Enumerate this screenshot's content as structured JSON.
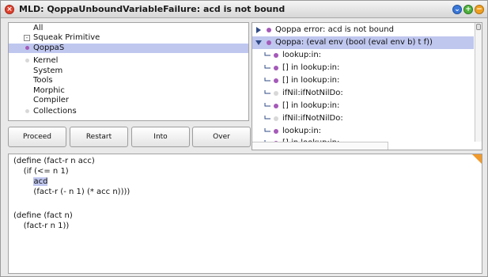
{
  "window": {
    "title": "MLD: QoppaUnboundVariableFailure: acd is not bound",
    "close_glyph": "×",
    "menu_glyph": "⌄",
    "expand_glyph": "+",
    "collapse_glyph": "−"
  },
  "class_list": {
    "items": [
      {
        "label": "All",
        "marker": "none",
        "selected": false
      },
      {
        "label": "Squeak Primitive",
        "marker": "box",
        "selected": false
      },
      {
        "label": "QoppaS",
        "marker": "purple",
        "selected": true
      },
      {
        "label": "Kernel",
        "marker": "grey",
        "selected": false
      },
      {
        "label": "System",
        "marker": "none",
        "selected": false
      },
      {
        "label": "Tools",
        "marker": "none",
        "selected": false
      },
      {
        "label": "Morphic",
        "marker": "none",
        "selected": false
      },
      {
        "label": "Compiler",
        "marker": "none",
        "selected": false
      },
      {
        "label": "Collections",
        "marker": "grey",
        "selected": false
      }
    ]
  },
  "buttons": {
    "proceed": "Proceed",
    "restart": "Restart",
    "into": "Into",
    "over": "Over"
  },
  "stack": {
    "frames": [
      {
        "label": "Qoppa error: acd is not bound",
        "kind": "collapsed",
        "marker": "purple",
        "selected": false
      },
      {
        "label": "Qoppa: (eval env (bool (eval env b) t f))",
        "kind": "expanded",
        "marker": "purple",
        "selected": true
      },
      {
        "label": "lookup:in:",
        "kind": "child",
        "marker": "purple",
        "selected": false
      },
      {
        "label": "[] in lookup:in:",
        "kind": "child",
        "marker": "purple",
        "selected": false
      },
      {
        "label": "[] in lookup:in:",
        "kind": "child",
        "marker": "purple",
        "selected": false
      },
      {
        "label": "ifNil:ifNotNilDo:",
        "kind": "child",
        "marker": "grey",
        "selected": false
      },
      {
        "label": "[] in lookup:in:",
        "kind": "child",
        "marker": "purple",
        "selected": false
      },
      {
        "label": "ifNil:ifNotNilDo:",
        "kind": "child",
        "marker": "grey",
        "selected": false
      },
      {
        "label": "lookup:in:",
        "kind": "child",
        "marker": "purple",
        "selected": false
      },
      {
        "label": "[] in lookup:in:",
        "kind": "child",
        "marker": "purple",
        "selected": false
      }
    ]
  },
  "code": {
    "lines": [
      {
        "prefix": "(define (fact-r n acc)",
        "highlight": "",
        "suffix": ""
      },
      {
        "prefix": "    (if (<= n 1)",
        "highlight": "",
        "suffix": ""
      },
      {
        "prefix": "        ",
        "highlight": "acd",
        "suffix": ""
      },
      {
        "prefix": "        (fact-r (- n 1) (* acc n))))",
        "highlight": "",
        "suffix": ""
      },
      {
        "prefix": "",
        "highlight": "",
        "suffix": ""
      },
      {
        "prefix": "(define (fact n)",
        "highlight": "",
        "suffix": ""
      },
      {
        "prefix": "    (fact-r n 1))",
        "highlight": "",
        "suffix": ""
      }
    ]
  },
  "colors": {
    "selection": "#bfc7ef",
    "close": "#e0412f",
    "menu": "#3a78d8",
    "expand": "#4fb13c",
    "collapse": "#f0a020",
    "marker_purple": "#a45ab8"
  },
  "icons": {
    "close": "close-icon",
    "menu": "window-menu-icon",
    "expand": "expand-icon",
    "collapse": "collapse-icon",
    "frame_marker": "bullet-icon",
    "tree_toggle": "disclosure-triangle-icon"
  }
}
